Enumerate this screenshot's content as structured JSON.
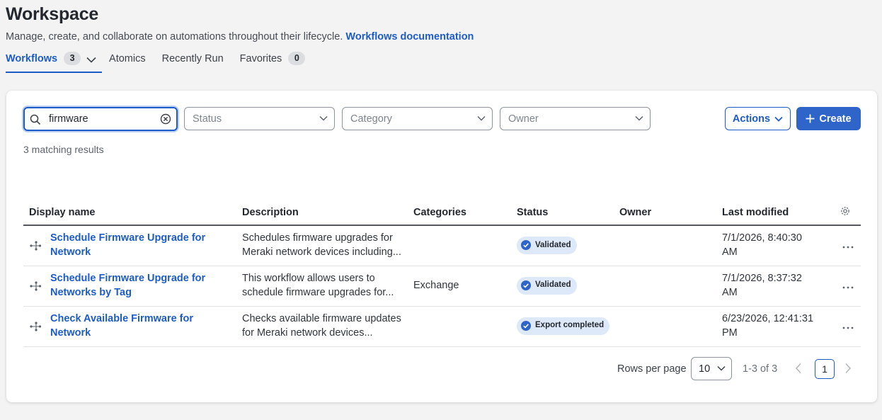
{
  "header": {
    "title": "Workspace",
    "subtitle": "Manage, create, and collaborate on automations throughout their lifecycle.",
    "doc_link": "Workflows documentation"
  },
  "tabs": [
    {
      "label": "Workflows",
      "count": "3",
      "active": true
    },
    {
      "label": "Atomics"
    },
    {
      "label": "Recently Run"
    },
    {
      "label": "Favorites",
      "count": "0"
    }
  ],
  "filters": {
    "search_value": "firmware",
    "status_placeholder": "Status",
    "category_placeholder": "Category",
    "owner_placeholder": "Owner",
    "actions_label": "Actions",
    "create_label": "Create"
  },
  "results_text": "3 matching results",
  "table": {
    "columns": [
      "Display name",
      "Description",
      "Categories",
      "Status",
      "Owner",
      "Last modified"
    ],
    "rows": [
      {
        "name_line1": "Schedule Firmware Upgrade for",
        "name_line2": "Network",
        "desc_line1": "Schedules firmware upgrades for",
        "desc_line2": "Meraki network devices including...",
        "category": "",
        "status": "Validated",
        "owner": "",
        "modified_line1": "7/1/2026, 8:40:30",
        "modified_line2": "AM"
      },
      {
        "name_line1": "Schedule Firmware Upgrade for",
        "name_line2": "Networks by Tag",
        "desc_line1": "This workflow allows users to",
        "desc_line2": "schedule firmware upgrades for...",
        "category": "Exchange",
        "status": "Validated",
        "owner": "",
        "modified_line1": "7/1/2026, 8:37:32",
        "modified_line2": "AM"
      },
      {
        "name_line1": "Check Available Firmware for",
        "name_line2": "Network",
        "desc_line1": "Checks available firmware updates",
        "desc_line2": "for Meraki network devices...",
        "category": "",
        "status": "Export completed",
        "owner": "",
        "modified_line1": "6/23/2026, 12:41:31",
        "modified_line2": "PM"
      }
    ]
  },
  "pagination": {
    "rows_per_page_label": "Rows per page",
    "rows_per_page_value": "10",
    "range": "1-3 of 3",
    "current_page": "1"
  },
  "colors": {
    "accent": "#1d5cc7",
    "badge_bg": "#dde9f9",
    "badge_icon": "#2f64c8"
  }
}
